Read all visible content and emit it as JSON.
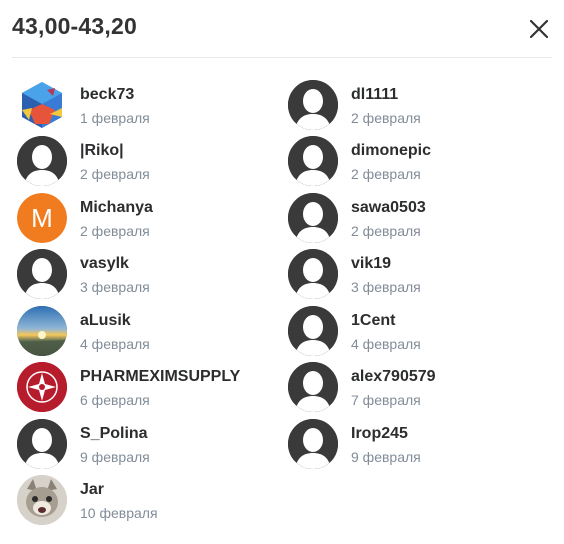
{
  "dialog": {
    "title": "43,00-43,20"
  },
  "icons": {
    "close": "close-icon",
    "default_avatar": "user-silhouette-icon"
  },
  "colors": {
    "name": "#2c2d2e",
    "date": "#818c99",
    "avatar_default": "#3a3a3a",
    "avatar_letter_bg": "#f07c1f"
  },
  "left_column": [
    {
      "name": "beck73",
      "date": "1 февраля",
      "avatar": "colorful-cube-logo"
    },
    {
      "name": "|Riko|",
      "date": "2 февраля",
      "avatar": "default"
    },
    {
      "name": "Michanya",
      "date": "2 февраля",
      "avatar": "letter",
      "letter": "M"
    },
    {
      "name": "vasylk",
      "date": "3 февраля",
      "avatar": "default"
    },
    {
      "name": "aLusik",
      "date": "4 февраля",
      "avatar": "sunset-photo"
    },
    {
      "name": "PHARMEXIMSUPPLY",
      "date": "6 февраля",
      "avatar": "red-emblem"
    },
    {
      "name": "S_Polina",
      "date": "9 февраля",
      "avatar": "default"
    },
    {
      "name": "Jar",
      "date": "10 февраля",
      "avatar": "cat-photo"
    }
  ],
  "right_column": [
    {
      "name": "dl1111",
      "date": "2 февраля",
      "avatar": "default"
    },
    {
      "name": "dimonepic",
      "date": "2 февраля",
      "avatar": "default"
    },
    {
      "name": "sawa0503",
      "date": "2 февраля",
      "avatar": "default"
    },
    {
      "name": "vik19",
      "date": "3 февраля",
      "avatar": "default"
    },
    {
      "name": "1Cent",
      "date": "4 февраля",
      "avatar": "default"
    },
    {
      "name": "alex790579",
      "date": "7 февраля",
      "avatar": "default"
    },
    {
      "name": "Irop245",
      "date": "9 февраля",
      "avatar": "default"
    }
  ]
}
